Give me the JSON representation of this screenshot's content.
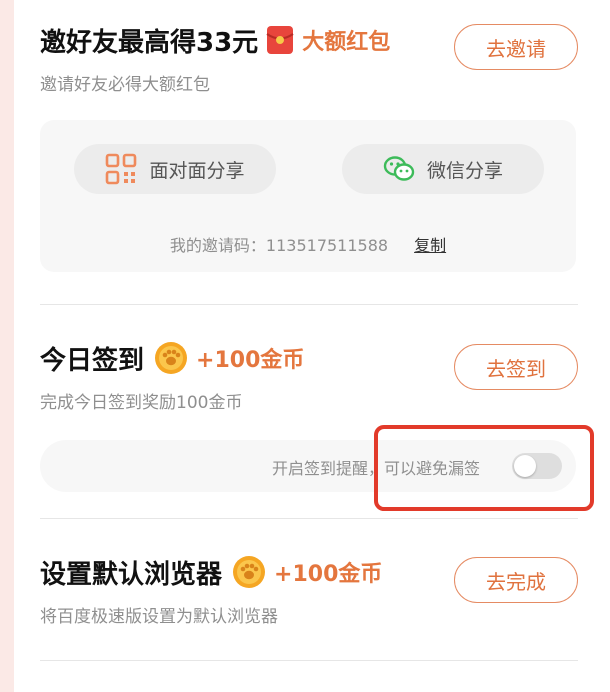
{
  "invite": {
    "title": "邀好友最高得33元",
    "reward": "大额红包",
    "subtitle": "邀请好友必得大额红包",
    "button": "去邀请",
    "share_face": "面对面分享",
    "share_wechat": "微信分享",
    "code_label": "我的邀请码：",
    "code_value": "113517511588",
    "copy_label": "复制"
  },
  "checkin": {
    "title": "今日签到",
    "reward": "+100金币",
    "subtitle": "完成今日签到奖励100金币",
    "button": "去签到",
    "reminder_text": "开启签到提醒，可以避免漏签",
    "reminder_enabled": false
  },
  "browser": {
    "title": "设置默认浏览器",
    "reward": "+100金币",
    "subtitle": "将百度极速版设置为默认浏览器",
    "button": "去完成"
  },
  "colors": {
    "accent": "#e0723e",
    "highlight": "#e23a2a"
  },
  "icons": [
    "red-envelope-icon",
    "qr-code-icon",
    "wechat-icon",
    "gold-coin-icon"
  ]
}
